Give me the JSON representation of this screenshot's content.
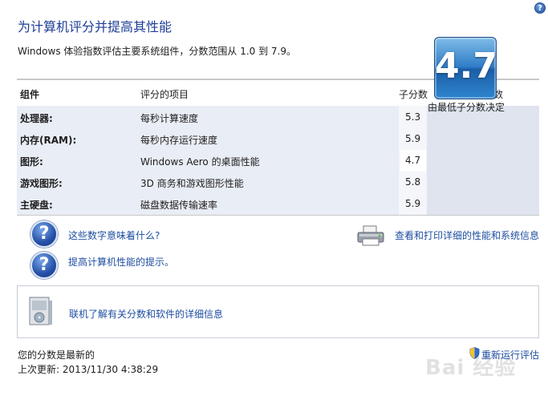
{
  "header": {
    "title": "为计算机评分并提高其性能",
    "subtitle": "Windows 体验指数评估主要系统组件，分数范围从 1.0 到 7.9。",
    "help_glyph": "?"
  },
  "table": {
    "col_component": "组件",
    "col_item": "评分的项目",
    "col_subscore": "子分数",
    "col_base": "基本分数",
    "rows": [
      {
        "component": "处理器:",
        "item": "每秒计算速度",
        "subscore": "5.3"
      },
      {
        "component": "内存(RAM):",
        "item": "每秒内存运行速度",
        "subscore": "5.9"
      },
      {
        "component": "图形:",
        "item": "Windows Aero 的桌面性能",
        "subscore": "4.7"
      },
      {
        "component": "游戏图形:",
        "item": "3D 商务和游戏图形性能",
        "subscore": "5.8"
      },
      {
        "component": "主硬盘:",
        "item": "磁盘数据传输速率",
        "subscore": "5.9"
      }
    ],
    "base_score": "4.7",
    "base_caption": "由最低子分数决定"
  },
  "links": {
    "what_numbers_mean": "这些数字意味着什么?",
    "improve_tips": "提高计算机性能的提示。",
    "print_details": "查看和打印详细的性能和系统信息",
    "online_info": "联机了解有关分数和软件的详细信息"
  },
  "footer": {
    "status": "您的分数是最新的",
    "last_update": "上次更新: 2013/11/30 4:38:29",
    "rerun": "重新运行评估",
    "watermark": "Bai 经验"
  },
  "icons": {
    "help": "help-icon",
    "question": "question-icon",
    "printer": "printer-icon",
    "software_box": "software-box-icon",
    "shield": "shield-icon"
  },
  "colors": {
    "title": "#1e3d96",
    "link": "#1e4ea0",
    "score_badge": "#2f7cc6",
    "table_bg": "#e9edf5"
  }
}
